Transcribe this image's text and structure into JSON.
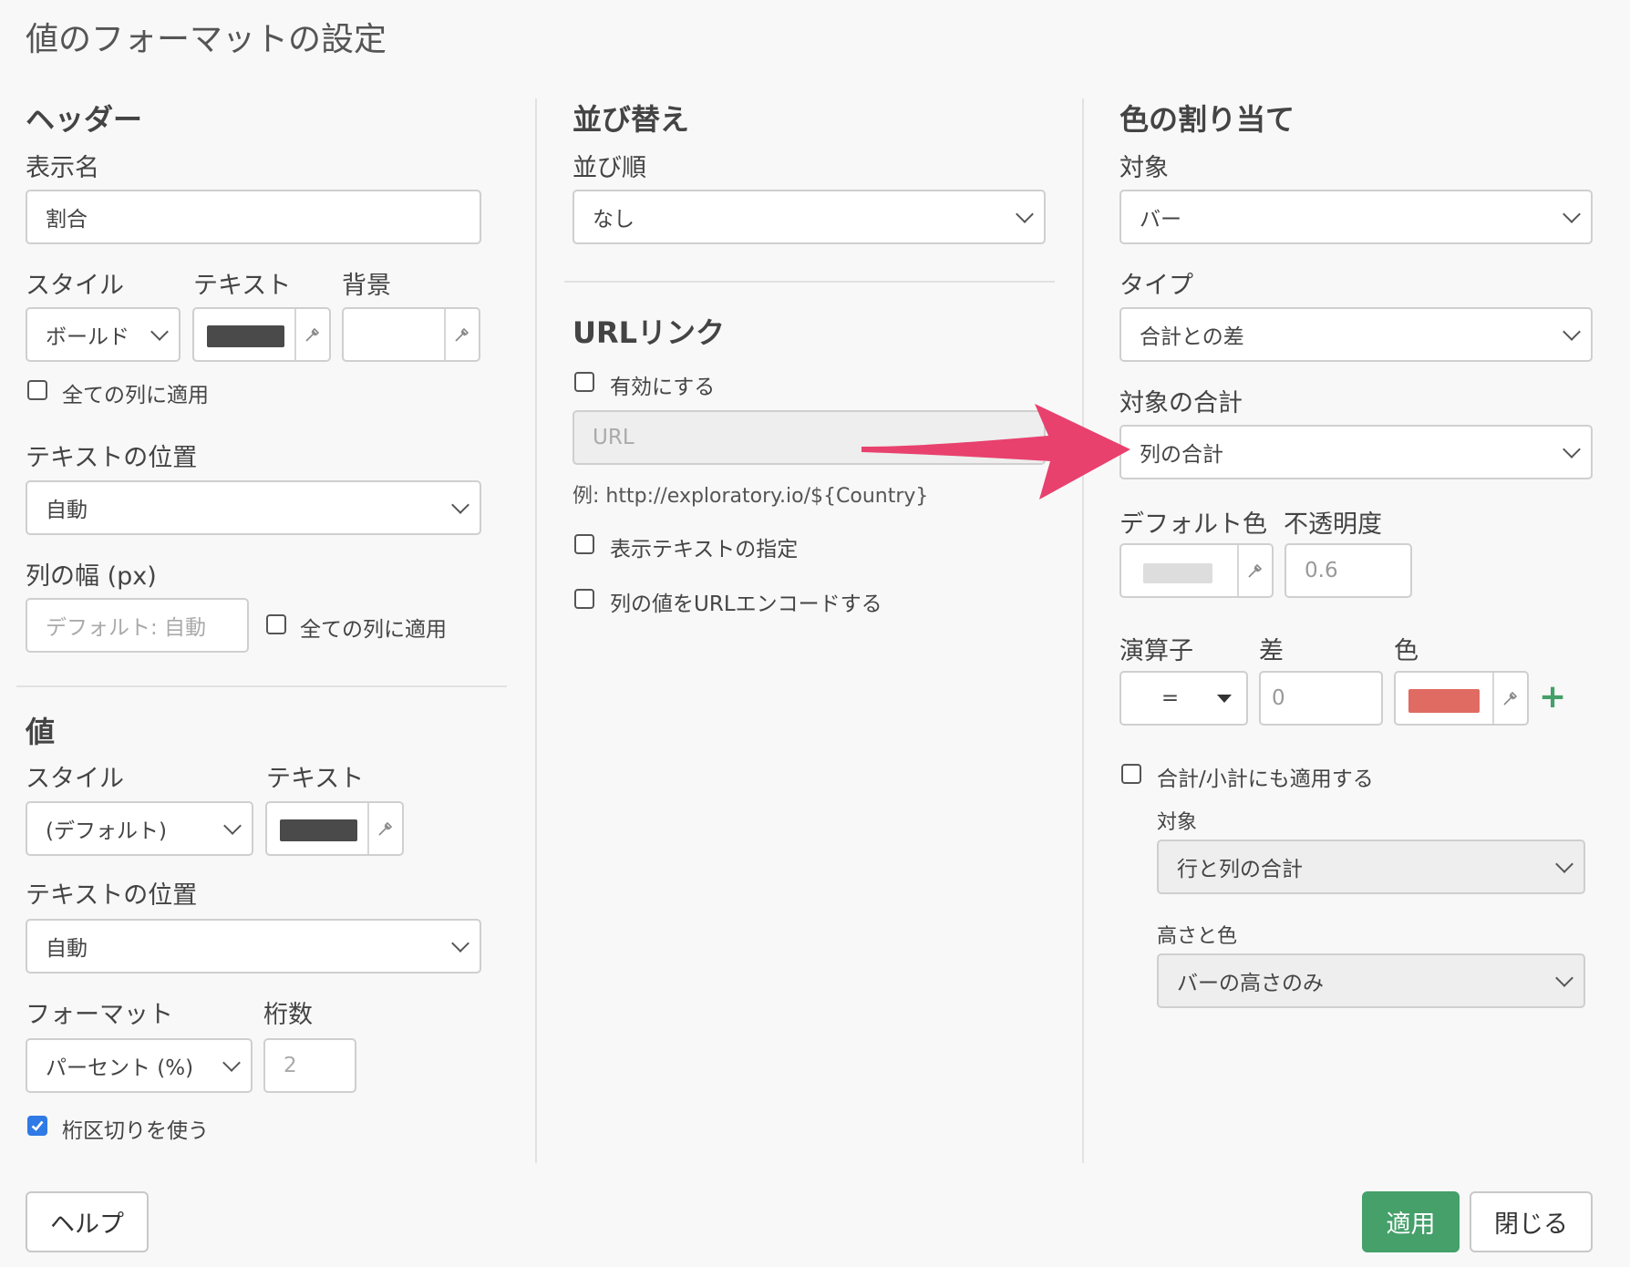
{
  "dialog": {
    "title": "値のフォーマットの設定"
  },
  "header": {
    "section_title": "ヘッダー",
    "display_name_label": "表示名",
    "display_name_value": "割合",
    "style_label": "スタイル",
    "text_label": "テキスト",
    "bg_label": "背景",
    "style_value": "ボールド",
    "text_color": "#4a4a4a",
    "apply_all_label": "全ての列に適用",
    "text_pos_label": "テキストの位置",
    "text_pos_value": "自動",
    "col_width_label": "列の幅 (px)",
    "col_width_placeholder": "デフォルト: 自動",
    "col_width_apply_all_label": "全ての列に適用"
  },
  "value": {
    "section_title": "値",
    "style_label": "スタイル",
    "text_label": "テキスト",
    "style_value": "(デフォルト)",
    "text_color": "#4a4a4a",
    "text_pos_label": "テキストの位置",
    "text_pos_value": "自動",
    "format_label": "フォーマット",
    "digits_label": "桁数",
    "format_value": "パーセント (%)",
    "digits_value": "2",
    "separator_label": "桁区切りを使う",
    "separator_checked": true
  },
  "sort": {
    "section_title": "並び替え",
    "order_label": "並び順",
    "order_value": "なし"
  },
  "url": {
    "section_title": "URLリンク",
    "enable_label": "有効にする",
    "url_placeholder": "URL",
    "example": "例: http://exploratory.io/${Country}",
    "display_text_label": "表示テキストの指定",
    "encode_label": "列の値をURLエンコードする"
  },
  "color": {
    "section_title": "色の割り当て",
    "target_label": "対象",
    "target_value": "バー",
    "type_label": "タイプ",
    "type_value": "合計との差",
    "target_total_label": "対象の合計",
    "target_total_value": "列の合計",
    "default_color_label": "デフォルト色",
    "opacity_label": "不透明度",
    "default_color": "#dddddd",
    "opacity_value": "0.6",
    "operator_label": "演算子",
    "diff_label": "差",
    "color_label": "色",
    "operator_value": "=",
    "diff_placeholder": "0",
    "rule_color": "#e06b63",
    "add_symbol": "+",
    "apply_subtotal_label": "合計/小計にも適用する",
    "sub_target_label": "対象",
    "sub_target_value": "行と列の合計",
    "height_color_label": "高さと色",
    "height_color_value": "バーの高さのみ"
  },
  "footer": {
    "help_label": "ヘルプ",
    "apply_label": "適用",
    "close_label": "閉じる"
  },
  "colors": {
    "accent_green": "#45a06a",
    "arrow_pink": "#e8416e",
    "check_blue": "#2f7ae5"
  }
}
